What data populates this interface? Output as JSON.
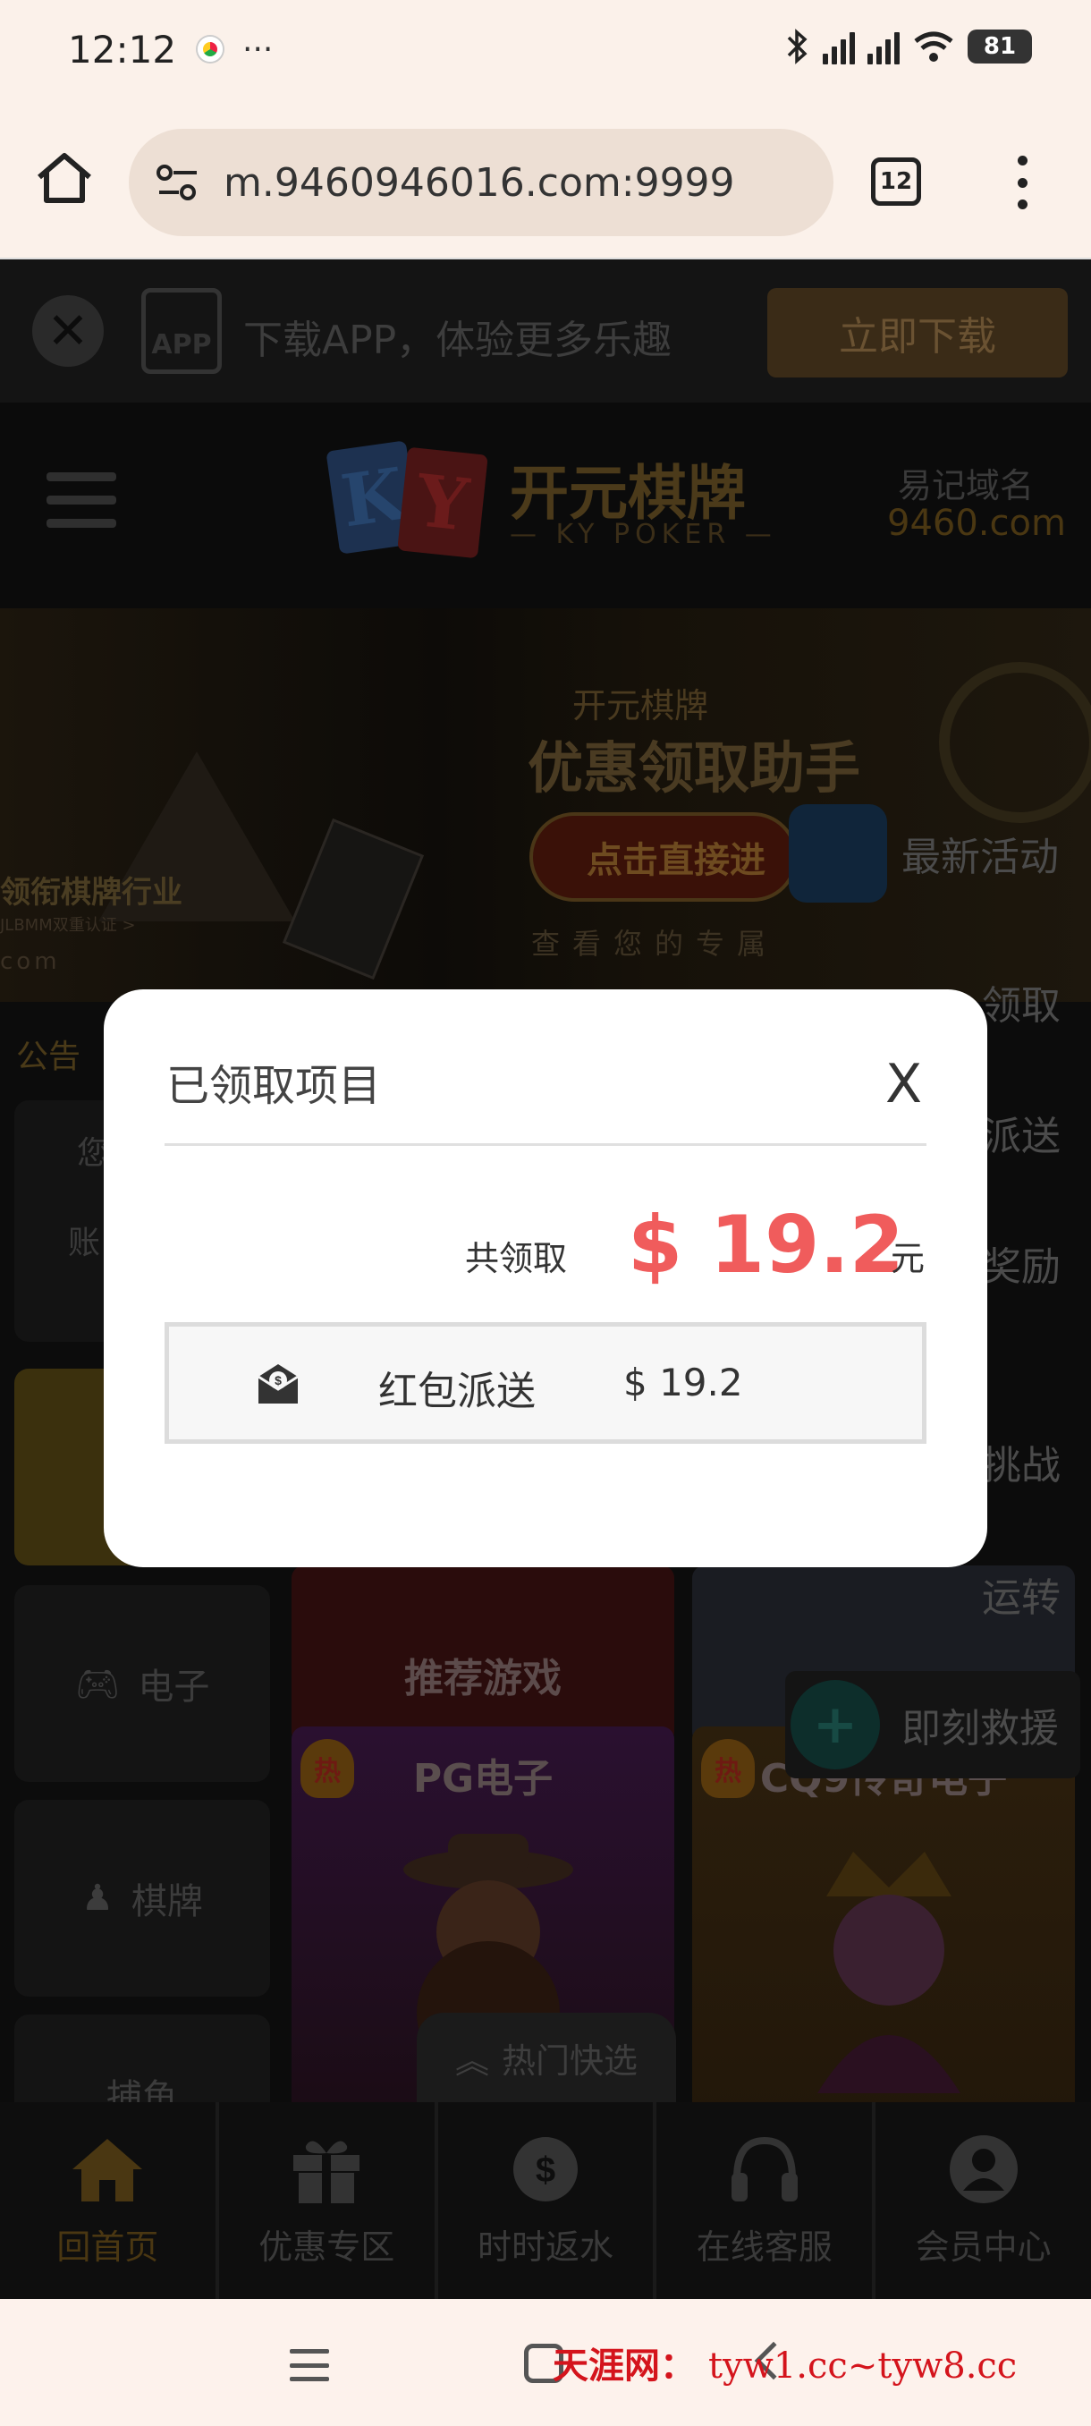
{
  "status_bar": {
    "time": "12:12",
    "more": "···",
    "battery": "81"
  },
  "browser": {
    "url": "m.9460946016.com:9999",
    "tab_count": "12"
  },
  "download_banner": {
    "app_badge": "APP",
    "text": "下载APP，体验更多乐趣",
    "button": "立即下载"
  },
  "header": {
    "logo_cn": "开元棋牌",
    "logo_en": "— KY POKER —",
    "logo_k": "K",
    "logo_y": "Y",
    "domain_label": "易记域名",
    "domain_value": "9460.com"
  },
  "banner": {
    "left_line1": "领衔棋牌行业",
    "left_line2": "JLBMM双重认证 >",
    "left_line3": "com",
    "right_line1": "开元棋牌",
    "right_line2": "优惠领取助手",
    "right_button": "点击直接进",
    "right_line3": "查看您的专属"
  },
  "notice_label": "公告",
  "left_card": {
    "t1": "您",
    "t2": "账"
  },
  "categories": [
    {
      "label": ""
    },
    {
      "label": "电子"
    },
    {
      "label": "棋牌"
    },
    {
      "label": "捕鱼"
    }
  ],
  "tiles": {
    "recommend": "推荐游戏",
    "pg": "PG电子",
    "cq9": "CQ9传奇电子",
    "hot_badge": "热"
  },
  "floating_menu": [
    {
      "label": "最新活动"
    },
    {
      "label": "领取"
    },
    {
      "label": "派送"
    },
    {
      "label": "奖励"
    },
    {
      "label": "挑战"
    },
    {
      "label": "运转"
    },
    {
      "label": "即刻救援"
    }
  ],
  "quick_select": "热门快选",
  "bottom_nav": [
    {
      "label": "回首页",
      "icon": "home-icon"
    },
    {
      "label": "优惠专区",
      "icon": "gift-icon"
    },
    {
      "label": "时时返水",
      "icon": "dollar-badge-icon"
    },
    {
      "label": "在线客服",
      "icon": "headset-icon"
    },
    {
      "label": "会员中心",
      "icon": "user-icon"
    }
  ],
  "modal": {
    "title": "已领取项目",
    "close": "X",
    "total_label": "共领取",
    "total_amount": "$ 19.2",
    "total_unit": "元",
    "items": [
      {
        "name": "红包派送",
        "amount": "$ 19.2"
      }
    ]
  },
  "watermark": {
    "brand": "天涯网：",
    "domains": "tyw1.cc~tyw8.cc"
  },
  "colors": {
    "accent_red": "#f05c5c",
    "gold": "#4a3712"
  }
}
